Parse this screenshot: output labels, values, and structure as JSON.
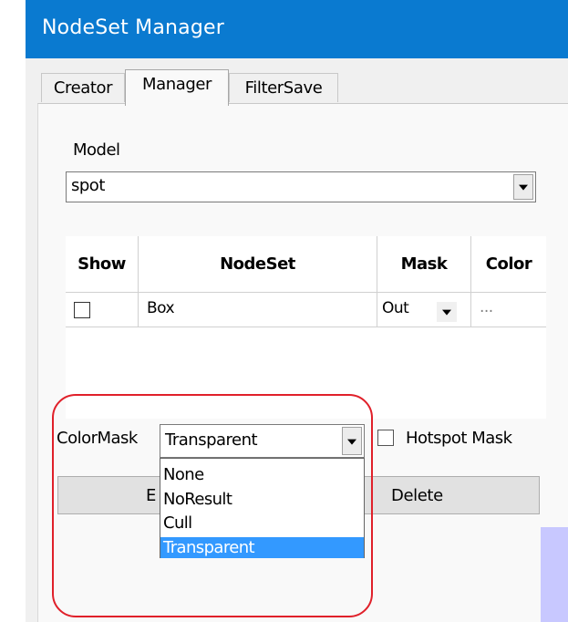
{
  "window": {
    "title": "NodeSet Manager",
    "accent": "#0a7ad0"
  },
  "tabs": [
    {
      "label": "Creator",
      "active": false
    },
    {
      "label": "Manager",
      "active": true
    },
    {
      "label": "FilterSave",
      "active": false
    }
  ],
  "model": {
    "label": "Model",
    "value": "spot"
  },
  "table": {
    "headers": [
      "Show",
      "NodeSet",
      "Mask",
      "Color"
    ],
    "rows": [
      {
        "show": false,
        "nodeset": "Box",
        "mask": "Out",
        "color": "..."
      }
    ]
  },
  "colormask": {
    "label": "ColorMask",
    "value": "Transparent",
    "options": [
      "None",
      "NoResult",
      "Cull",
      "Transparent"
    ],
    "selected": "Transparent"
  },
  "hotspot_mask": {
    "label": "Hotspot Mask",
    "checked": false
  },
  "buttons": {
    "edit_label": "E",
    "delete_label": "Delete"
  },
  "colors": {
    "highlight_ring": "#e0202a",
    "selected_option": "#3399ff"
  }
}
